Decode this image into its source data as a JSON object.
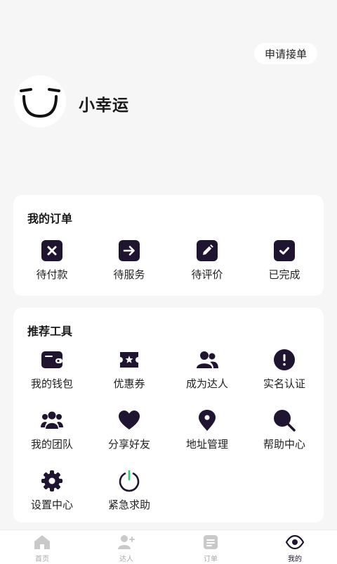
{
  "header": {
    "apply_label": "申请接单",
    "nickname": "小幸运"
  },
  "orders": {
    "title": "我的订单",
    "items": [
      {
        "label": "待付款",
        "icon": "close-square-icon"
      },
      {
        "label": "待服务",
        "icon": "arrow-right-square-icon"
      },
      {
        "label": "待评价",
        "icon": "pencil-square-icon"
      },
      {
        "label": "已完成",
        "icon": "check-square-icon"
      }
    ]
  },
  "tools": {
    "title": "推荐工具",
    "items": [
      {
        "label": "我的钱包",
        "icon": "wallet-icon"
      },
      {
        "label": "优惠券",
        "icon": "coupon-icon"
      },
      {
        "label": "成为达人",
        "icon": "users-icon"
      },
      {
        "label": "实名认证",
        "icon": "alert-circle-icon"
      },
      {
        "label": "我的团队",
        "icon": "team-icon"
      },
      {
        "label": "分享好友",
        "icon": "heart-icon"
      },
      {
        "label": "地址管理",
        "icon": "location-pin-icon"
      },
      {
        "label": "帮助中心",
        "icon": "search-icon"
      },
      {
        "label": "设置中心",
        "icon": "gear-icon"
      },
      {
        "label": "紧急求助",
        "icon": "power-icon"
      }
    ]
  },
  "tabbar": {
    "items": [
      {
        "label": "首页",
        "icon": "home-icon"
      },
      {
        "label": "达人",
        "icon": "add-user-icon"
      },
      {
        "label": "订单",
        "icon": "document-icon"
      },
      {
        "label": "我的",
        "icon": "eye-icon",
        "active": true
      }
    ]
  },
  "colors": {
    "icon_dark": "#1f1530",
    "accent_green": "#2ecc71",
    "inactive": "#c9c9c9",
    "background": "#f6f6f6"
  }
}
